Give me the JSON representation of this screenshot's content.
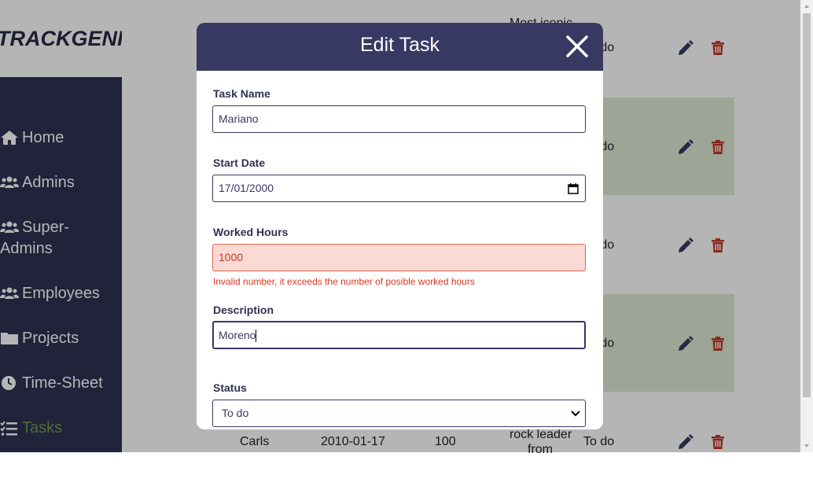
{
  "app": {
    "logo": "TRACKGENIX"
  },
  "sidebar": {
    "items": [
      {
        "label": "Home",
        "icon": "home-icon"
      },
      {
        "label": "Admins",
        "icon": "users-icon"
      },
      {
        "label": "Super-Admins",
        "line1": "Super-",
        "line2": "Admins",
        "icon": "users-icon"
      },
      {
        "label": "Employees",
        "icon": "users-icon"
      },
      {
        "label": "Projects",
        "icon": "folder-icon"
      },
      {
        "label": "Time-Sheet",
        "icon": "clock-icon"
      },
      {
        "label": "Tasks",
        "icon": "tasks-icon",
        "active": true
      }
    ]
  },
  "table": {
    "rows": [
      {
        "status": "To do",
        "partial_text": "Most iconic"
      },
      {
        "status": "To do"
      },
      {
        "status": "To do"
      },
      {
        "status": "To do"
      },
      {
        "name": "Carls",
        "start_date": "2010-01-17",
        "hours": "100",
        "description_line1": "rock leader",
        "description_line2": "from",
        "status": "To do"
      }
    ]
  },
  "modal": {
    "title": "Edit Task",
    "fields": {
      "task_name": {
        "label": "Task Name",
        "value": "Mariano"
      },
      "start_date": {
        "label": "Start Date",
        "value": "17/01/2000"
      },
      "worked_hours": {
        "label": "Worked Hours",
        "value": "1000",
        "error": "Invalid number, it exceeds the number of posible worked hours"
      },
      "description": {
        "label": "Description",
        "value": "Moreno"
      },
      "status": {
        "label": "Status",
        "value": "To do"
      }
    }
  },
  "colors": {
    "sidebar_bg": "#2e3252",
    "modal_header": "#383963",
    "active_nav": "#6c9a52",
    "error_bg": "#fbd9d5",
    "error_text": "#d9371f",
    "delete_icon": "#c0392b",
    "row_shade": "#dde9d4"
  }
}
